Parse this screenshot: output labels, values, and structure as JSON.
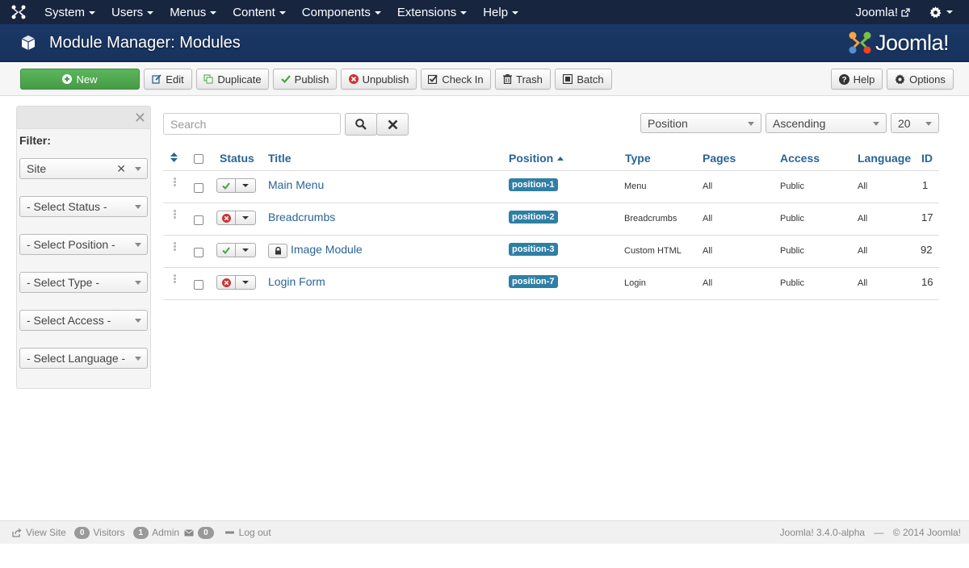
{
  "nav": {
    "logo_icon": "joomla-icon",
    "items": [
      "System",
      "Users",
      "Menus",
      "Content",
      "Components",
      "Extensions",
      "Help"
    ],
    "site_label": "Joomla!",
    "external_icon": "external-link-icon",
    "settings_icon": "gear-icon"
  },
  "header": {
    "icon": "cube-icon",
    "title": "Module Manager: Modules",
    "brand": "Joomla!"
  },
  "toolbar": {
    "new": "New",
    "edit": "Edit",
    "duplicate": "Duplicate",
    "publish": "Publish",
    "unpublish": "Unpublish",
    "checkin": "Check In",
    "trash": "Trash",
    "batch": "Batch",
    "help": "Help",
    "options": "Options"
  },
  "sidebar": {
    "filter_label": "Filter:",
    "client": "Site",
    "status": "- Select Status -",
    "position": "- Select Position -",
    "type": "- Select Type -",
    "access": "- Select Access -",
    "language": "- Select Language -"
  },
  "search": {
    "placeholder": "Search"
  },
  "list": {
    "ordering": "Position",
    "direction": "Ascending",
    "limit": "20"
  },
  "table": {
    "headers": {
      "status": "Status",
      "title": "Title",
      "position": "Position",
      "type": "Type",
      "pages": "Pages",
      "access": "Access",
      "language": "Language",
      "id": "ID"
    },
    "rows": [
      {
        "title": "Main Menu",
        "published": true,
        "locked": false,
        "position": "position-1",
        "type": "Menu",
        "pages": "All",
        "access": "Public",
        "language": "All",
        "id": "1"
      },
      {
        "title": "Breadcrumbs",
        "published": false,
        "locked": false,
        "position": "position-2",
        "type": "Breadcrumbs",
        "pages": "All",
        "access": "Public",
        "language": "All",
        "id": "17"
      },
      {
        "title": "Image Module",
        "published": true,
        "locked": true,
        "position": "position-3",
        "type": "Custom HTML",
        "pages": "All",
        "access": "Public",
        "language": "All",
        "id": "92"
      },
      {
        "title": "Login Form",
        "published": false,
        "locked": false,
        "position": "position-7",
        "type": "Login",
        "pages": "All",
        "access": "Public",
        "language": "All",
        "id": "16"
      }
    ]
  },
  "footer": {
    "view_site": "View Site",
    "visitors_count": "0",
    "visitors": "Visitors",
    "admin_count": "1",
    "admin": "Admin",
    "messages_count": "0",
    "logout": "Log out",
    "version": "Joomla! 3.4.0-alpha",
    "sep": "—",
    "copyright": "© 2014 Joomla!"
  },
  "colors": {
    "navbar": "#17253f",
    "header": "#1a3867",
    "link": "#2a6496",
    "badge": "#2f7fa5",
    "new_button": "#5bb75b"
  }
}
